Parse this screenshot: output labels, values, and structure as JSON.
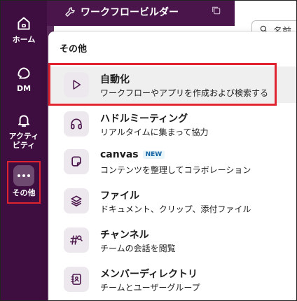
{
  "header": {
    "title": "ワークフロービルダー"
  },
  "search": {
    "text": "名前"
  },
  "rail": {
    "home": "ホーム",
    "dm": "DM",
    "activity_line1": "アクティ",
    "activity_line2": "ビティ",
    "more": "その他"
  },
  "menu": {
    "title": "その他",
    "items": [
      {
        "name": "自動化",
        "desc": "ワークフローやアプリを作成および検索する",
        "icon": "play-icon"
      },
      {
        "name": "ハドルミーティング",
        "desc": "リアルタイムに集まって協力",
        "icon": "headphones-icon"
      },
      {
        "name": "canvas",
        "badge": "NEW",
        "desc": "コンテンツを整理してコラボレーション",
        "icon": "canvas-icon"
      },
      {
        "name": "ファイル",
        "desc": "ドキュメント、クリップ、添付ファイル",
        "icon": "layers-icon"
      },
      {
        "name": "チャンネル",
        "desc": "チームの会話を閲覧",
        "icon": "channel-search-icon"
      },
      {
        "name": "メンバーディレクトリ",
        "desc": "チームとユーザーグループ",
        "icon": "contact-book-icon"
      }
    ]
  },
  "colors": {
    "rail_bg": "#3f0e40",
    "header_bg": "#4a154b",
    "highlight_red": "#e0242f",
    "icon_tile": "#ede8ed",
    "new_badge": "#1264a3"
  }
}
